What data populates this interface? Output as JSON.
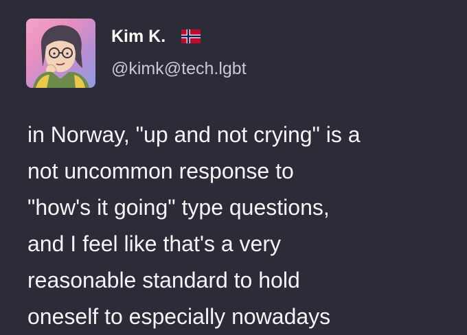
{
  "author": {
    "display_name": "Kim K.",
    "flag": "norway-flag-icon",
    "handle": "@kimk@tech.lgbt",
    "avatar": "avatar-illustration"
  },
  "post": {
    "lines": [
      "in Norway, \"up and not crying\" is a",
      "not uncommon response to",
      "\"how's it going\" type questions,",
      "and I feel like that's a very",
      "reasonable standard to hold",
      "oneself to especially nowadays"
    ]
  },
  "colors": {
    "background": "#2b2c37",
    "text": "#f5f5f7",
    "handle": "#c9c9d6",
    "flag_red": "#ba0c2f",
    "flag_blue": "#00205b"
  }
}
